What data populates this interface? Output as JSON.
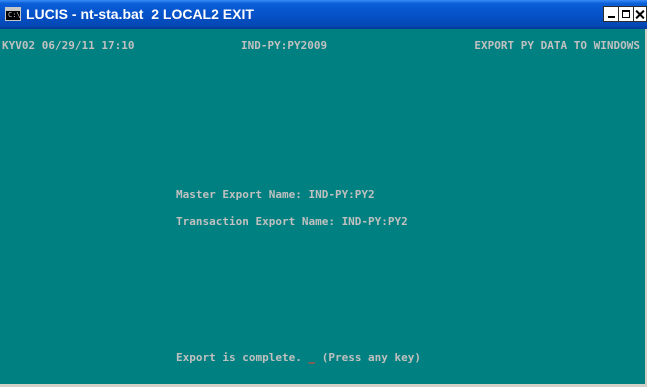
{
  "window": {
    "title": "LUCIS - nt-sta.bat  2 LOCAL2 EXIT",
    "icon": "console-icon",
    "icon_glyph": "C:\\",
    "controls": [
      "minimize",
      "maximize",
      "close"
    ]
  },
  "console": {
    "background_color": "#008080",
    "text_color": "#c0c0c0",
    "header": {
      "left": "KYV02 06/29/11 17:10",
      "center": "IND-PY:PY2009",
      "right": "EXPORT PY DATA TO WINDOWS"
    },
    "master_export_line": "Master Export Name: IND-PY:PY2",
    "transaction_export_line": "Transaction Export Name: IND-PY:PY2",
    "status": {
      "message": "Export is complete. ",
      "cursor": "_",
      "prompt": " (Press any key)"
    }
  }
}
